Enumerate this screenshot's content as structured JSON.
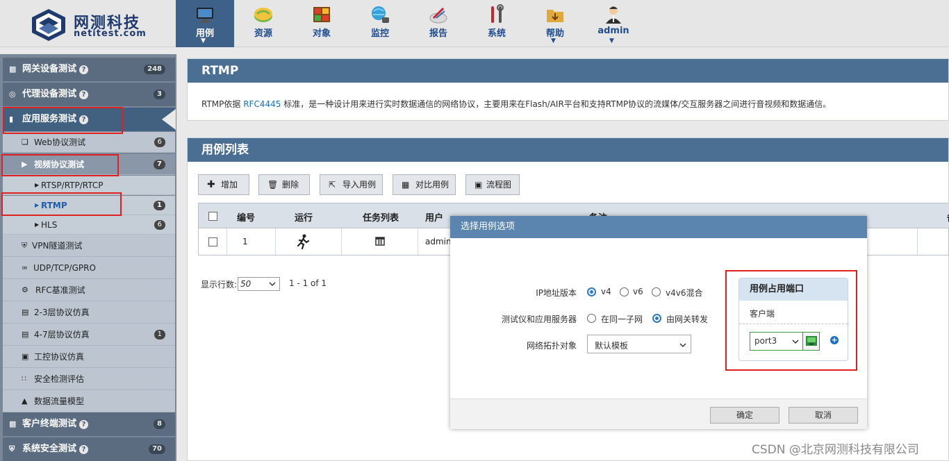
{
  "brand": {
    "name_cn": "网测科技",
    "name_en": "netitest.com"
  },
  "nav": [
    {
      "label": "用例",
      "icon": "monitor-icon",
      "active": true,
      "caret": true
    },
    {
      "label": "资源",
      "icon": "resource-disc-icon",
      "active": false,
      "caret": false
    },
    {
      "label": "对象",
      "icon": "object-grid-icon",
      "active": false,
      "caret": false
    },
    {
      "label": "监控",
      "icon": "monitor-globe-icon",
      "active": false,
      "caret": false
    },
    {
      "label": "报告",
      "icon": "report-icon",
      "active": false,
      "caret": false
    },
    {
      "label": "系统",
      "icon": "tools-icon",
      "active": false,
      "caret": false
    },
    {
      "label": "帮助",
      "icon": "help-folder-icon",
      "active": false,
      "caret": true
    },
    {
      "label": "admin",
      "icon": "user-icon",
      "active": false,
      "caret": true
    }
  ],
  "sidebar": {
    "items": [
      {
        "label": "网关设备测试",
        "badge": "248",
        "hint": "?"
      },
      {
        "label": "代理设备测试",
        "badge": "3",
        "hint": "?"
      },
      {
        "label": "应用服务测试",
        "hint": "?"
      },
      {
        "label": "Web协议测试",
        "badge": "6"
      },
      {
        "label": "视频协议测试",
        "badge": "7"
      },
      {
        "label": "RTSP/RTP/RTCP"
      },
      {
        "label": "RTMP",
        "badge": "1"
      },
      {
        "label": "HLS",
        "badge": "6"
      },
      {
        "label": "VPN隧道测试"
      },
      {
        "label": "UDP/TCP/GPRO"
      },
      {
        "label": "RFC基准测试"
      },
      {
        "label": "2-3层协议仿真"
      },
      {
        "label": "4-7层协议仿真",
        "badge": "1"
      },
      {
        "label": "工控协议仿真"
      },
      {
        "label": "安全检测评估"
      },
      {
        "label": "数据流量模型"
      },
      {
        "label": "客户终端测试",
        "badge": "8",
        "hint": "?"
      },
      {
        "label": "系统安全测试",
        "badge": "70",
        "hint": "?"
      }
    ]
  },
  "intro": {
    "title": "RTMP",
    "text_pre": "RTMP依据",
    "link": "RFC4445",
    "text_post": "标准，是一种设计用来进行实时数据通信的网络协议，主要用来在Flash/AIR平台和支持RTMP协议的流媒体/交互服务器之间进行音视频和数据通信。"
  },
  "cases": {
    "title": "用例列表",
    "toolbar": [
      {
        "label": "增加",
        "icon": "plus-icon"
      },
      {
        "label": "删除",
        "icon": "trash-icon"
      },
      {
        "label": "导入用例",
        "icon": "import-icon"
      },
      {
        "label": "对比用例",
        "icon": "compare-chart-icon"
      },
      {
        "label": "流程图",
        "icon": "flowchart-icon"
      }
    ],
    "columns": [
      "编号",
      "运行",
      "任务列表",
      "用户",
      "备注",
      "备"
    ],
    "rows": [
      {
        "id": "1",
        "run": "run-icon",
        "tasks": "calendar-icon",
        "user": "admin"
      }
    ],
    "pagination": {
      "label": "显示行数:",
      "value": "50",
      "range": "1 - 1 of 1"
    }
  },
  "modal": {
    "title": "选择用例选项",
    "ip_version": {
      "label": "IP地址版本",
      "options": [
        "v4",
        "v6",
        "v4v6混合"
      ],
      "selected": "v4"
    },
    "placement": {
      "label": "测试仪和应用服务器",
      "options": [
        "在同一子网",
        "由网关转发"
      ],
      "selected": "由网关转发"
    },
    "topology": {
      "label": "网络拓扑对象",
      "value": "默认模板"
    },
    "ports": {
      "title": "用例占用端口",
      "role": "客户端",
      "port": "port3"
    },
    "ok": "确定",
    "cancel": "取消"
  },
  "credit": "CSDN @北京网测科技有限公司"
}
